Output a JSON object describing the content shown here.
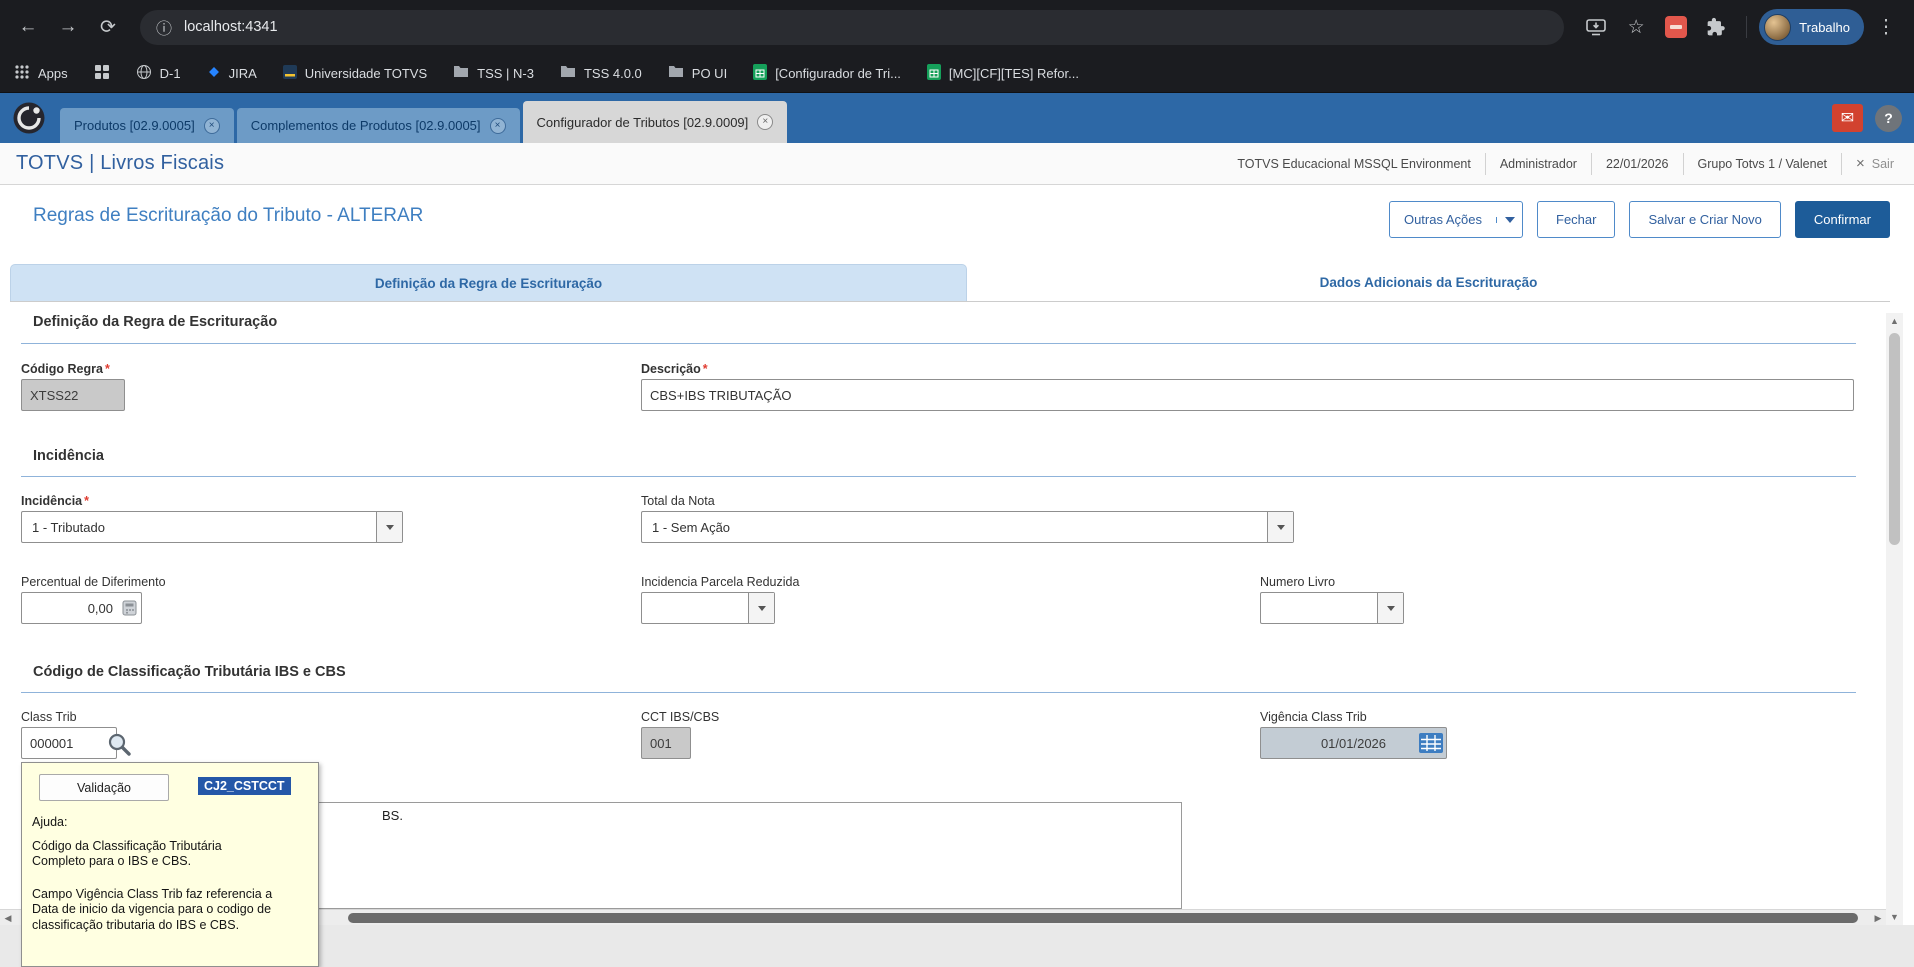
{
  "browser": {
    "url": "localhost:4341",
    "profile_label": "Trabalho",
    "bookmarks": {
      "apps_label": "Apps",
      "items": [
        {
          "label": "D-1"
        },
        {
          "label": "JIRA"
        },
        {
          "label": "Universidade TOTVS"
        },
        {
          "label": "TSS | N-3"
        },
        {
          "label": "TSS 4.0.0"
        },
        {
          "label": "PO UI"
        },
        {
          "label": "[Configurador de Tri..."
        },
        {
          "label": "[MC][CF][TES] Refor..."
        }
      ]
    }
  },
  "workspace": {
    "tabs": [
      {
        "label": "Produtos [02.9.0005]"
      },
      {
        "label": "Complementos de Produtos [02.9.0005]"
      },
      {
        "label": "Configurador de Tributos [02.9.0009]"
      }
    ]
  },
  "app_header": {
    "title": "TOTVS | Livros Fiscais",
    "environment": "TOTVS Educacional MSSQL Environment",
    "user": "Administrador",
    "date": "22/01/2026",
    "group": "Grupo Totvs 1 / Valenet",
    "exit_label": "Sair"
  },
  "page": {
    "title": "Regras de Escrituração do Tributo - ALTERAR",
    "required_marker": "*",
    "buttons": {
      "outras_acoes": "Outras Ações",
      "fechar": "Fechar",
      "salvar_criar_novo": "Salvar e Criar Novo",
      "confirmar": "Confirmar"
    },
    "tabs": {
      "definicao": "Definição da Regra de Escrituração",
      "dados_adicionais": "Dados Adicionais da Escrituração"
    }
  },
  "sections": {
    "definicao_title": "Definição da Regra de Escrituração",
    "incidencia_title": "Incidência",
    "classificacao_title": "Código de Classificação Tributária IBS e CBS"
  },
  "fields": {
    "codigo_regra": {
      "label": "Código Regra",
      "value": "XTSS22"
    },
    "descricao": {
      "label": "Descrição",
      "value": "CBS+IBS TRIBUTAÇÃO"
    },
    "incidencia": {
      "label": "Incidência",
      "value": "1 - Tributado"
    },
    "total_da_nota": {
      "label": "Total da Nota",
      "value": "1 - Sem Ação"
    },
    "percentual_diferimento": {
      "label": "Percentual de Diferimento",
      "value": "0,00"
    },
    "incidencia_parcela_reduzida": {
      "label": "Incidencia Parcela Reduzida",
      "value": ""
    },
    "numero_livro": {
      "label": "Numero Livro",
      "value": ""
    },
    "class_trib": {
      "label": "Class Trib",
      "value": "000001"
    },
    "cct_ibs_cbs": {
      "label": "CCT IBS/CBS",
      "value": "001"
    },
    "vigencia_class_trib": {
      "label": "Vigência Class Trib",
      "value": "01/01/2026"
    },
    "textarea_visible_fragment": "BS."
  },
  "help_popup": {
    "validacao_label": "Validação",
    "field_code": "CJ2_CSTCCT",
    "ajuda_label": "Ajuda:",
    "paragraph1": "Código da Classificação Tributária Completo para o IBS e CBS.",
    "paragraph2": "Campo Vigência Class Trib faz referencia a Data de inicio da vigencia para o codigo de classificação tributaria do IBS e CBS."
  },
  "icons": {
    "back": "←",
    "forward": "→",
    "refresh": "⟳",
    "site_info": "ⓘ",
    "star": "☆",
    "kebab": "⋮",
    "envelope": "✉",
    "help": "?",
    "close": "×",
    "scroll_up": "▲",
    "scroll_down": "▼",
    "scroll_left": "◀",
    "scroll_right": "▶"
  },
  "colors": {
    "accent_blue": "#2d68a6",
    "link_blue": "#31609f",
    "confirm_blue": "#1d5c99",
    "required_red": "#e03c31",
    "tooltip_yellow": "#ffffe1"
  }
}
